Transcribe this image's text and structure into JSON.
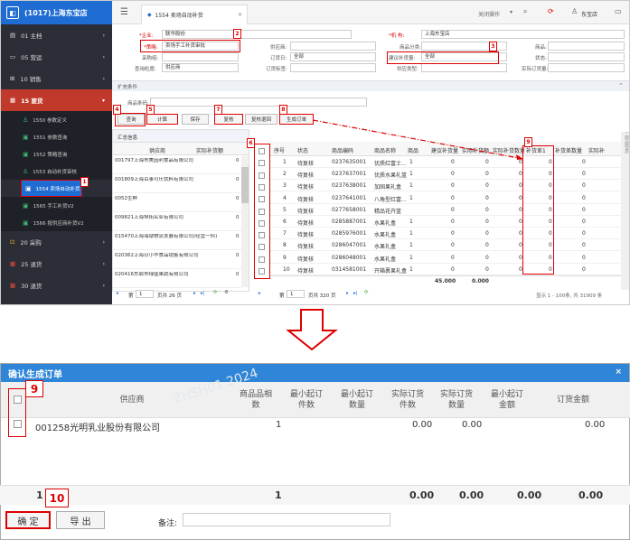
{
  "app": {
    "brand": "(1017)上海东宝店"
  },
  "sidebar": {
    "items": [
      {
        "label": "01 主档"
      },
      {
        "label": "05 营运"
      },
      {
        "label": "10 销售"
      },
      {
        "label": "15 要货"
      }
    ],
    "sub_items": [
      {
        "label": "1550 参数定义"
      },
      {
        "label": "1551 参数查询"
      },
      {
        "label": "1552 策略查询"
      },
      {
        "label": "1553 自动补货审核"
      },
      {
        "label": "1554 卖场自动补货"
      },
      {
        "label": "1565 手工补货V2"
      },
      {
        "label": "1566 按供应商补货V2"
      }
    ],
    "bottom_items": [
      {
        "label": "20 采购"
      },
      {
        "label": "25 退货"
      },
      {
        "label": "30 退货"
      }
    ]
  },
  "header": {
    "tab_label": "1554 卖场自动补货",
    "menu_label": "关闭操作",
    "store_label": "东宝店"
  },
  "form": {
    "enterprise_label": "*企业:",
    "enterprise_value": "联华股份",
    "org_label": "*机 构:",
    "org_value": "上海东宝店",
    "strategy_label": "*策略:",
    "strategy_value": "卖场手工补货审批",
    "supplier_label": "供应商:",
    "category_label": "商品分类:",
    "goods_label": "商品:",
    "purchaser_label": "采购组:",
    "order_day_label": "订货日:",
    "order_day_value": "全部",
    "suggest_label": "建议补货量:",
    "suggest_value": "全部",
    "status_label": "状态:",
    "season_label": "查询粒度:",
    "season_value": "供应商",
    "order_tag_label": "订货标签:",
    "supplier_type_label": "供应类型:",
    "actual_label": "实际订货量:",
    "expand_label": "扩充条件",
    "goods_cond_label": "商品条码:"
  },
  "toolbar": {
    "query": "查询",
    "calc": "计算",
    "save": "保存",
    "review": "复核",
    "review_back": "复核退回",
    "gen_order": "生成订单"
  },
  "left_grid": {
    "title": "汇总信息",
    "headers": [
      "供应商",
      "实际补货额"
    ],
    "rows": [
      {
        "supplier": "001797上海市美因利食品有限公司",
        "value": "0"
      },
      {
        "supplier": "001809上海百事可乐饮料有限公司",
        "value": "0"
      },
      {
        "supplier": "0052生鲜",
        "value": "0"
      },
      {
        "supplier": "009821上海恒拓实业有限公司",
        "value": "0"
      },
      {
        "supplier": "015470上海海墩物流发展有限公司(经营一科)",
        "value": "0"
      },
      {
        "supplier": "020362上海日小华食品销售有限公司",
        "value": "0"
      },
      {
        "supplier": "020416东启市绿盛果蔬有限公司",
        "value": "0"
      }
    ],
    "page": "1",
    "page_total": "页共 26 页",
    "first_label": "第"
  },
  "right_grid": {
    "headers": [
      "序号",
      "状态",
      "商品编码",
      "商品名称",
      "商品",
      "建议补货量",
      "实际补货额",
      "实际补货数量",
      "补货差1",
      "补货差数量",
      "实际补"
    ],
    "rows": [
      {
        "idx": "1",
        "status": "待复核",
        "code": "0237635001",
        "name": "优质红富士...",
        "g": "1",
        "a": "0",
        "b": "0",
        "c": "0",
        "d": "0",
        "e": "0"
      },
      {
        "idx": "2",
        "status": "待复核",
        "code": "0237637001",
        "name": "优质水果礼篮",
        "g": "1",
        "a": "0",
        "b": "0",
        "c": "0",
        "d": "0",
        "e": "0"
      },
      {
        "idx": "3",
        "status": "待复核",
        "code": "0237638001",
        "name": "加固果礼盒",
        "g": "1",
        "a": "0",
        "b": "0",
        "c": "0",
        "d": "0",
        "e": "0"
      },
      {
        "idx": "4",
        "status": "待复核",
        "code": "0237641001",
        "name": "八角型红富...",
        "g": "1",
        "a": "0",
        "b": "0",
        "c": "0",
        "d": "0",
        "e": "0"
      },
      {
        "idx": "5",
        "status": "待复核",
        "code": "0277658001",
        "name": "精品花卉篮",
        "g": "",
        "a": "0",
        "b": "0",
        "c": "0",
        "d": "0",
        "e": "0"
      },
      {
        "idx": "6",
        "status": "待复核",
        "code": "0285887001",
        "name": "水果礼盒",
        "g": "1",
        "a": "0",
        "b": "0",
        "c": "0",
        "d": "0",
        "e": "0"
      },
      {
        "idx": "7",
        "status": "待复核",
        "code": "0285976001",
        "name": "水果礼盒",
        "g": "1",
        "a": "0",
        "b": "0",
        "c": "0",
        "d": "0",
        "e": "0"
      },
      {
        "idx": "8",
        "status": "待复核",
        "code": "0286047001",
        "name": "水果礼盒",
        "g": "1",
        "a": "0",
        "b": "0",
        "c": "0",
        "d": "0",
        "e": "0"
      },
      {
        "idx": "9",
        "status": "待复核",
        "code": "0286048001",
        "name": "水果礼盒",
        "g": "1",
        "a": "0",
        "b": "0",
        "c": "0",
        "d": "0",
        "e": "0"
      },
      {
        "idx": "10",
        "status": "待复核",
        "code": "0314581001",
        "name": "开箱裹果礼盒",
        "g": "1",
        "a": "0",
        "b": "0",
        "c": "0",
        "d": "0",
        "e": "0"
      }
    ],
    "totals": {
      "a": "45.000",
      "b": "0.000"
    },
    "page": "1",
    "page_total": "页共 320 页",
    "first_label": "第",
    "summary": "显示 1 - 100条, 共 31909 条"
  },
  "callouts": [
    "1",
    "2",
    "3",
    "4",
    "5",
    "6",
    "7",
    "8",
    "9",
    "10"
  ],
  "dialog": {
    "title": "确认生成订单",
    "close": "×",
    "headers": {
      "supplier": "供应商",
      "goods_count": "商品品相数",
      "min_pieces": "最小起订件数",
      "min_qty": "最小起订数量",
      "actual_pieces": "实际订货件数",
      "actual_qty": "实际订货数量",
      "min_amount": "最小起订金额",
      "order_amount": "订货金额"
    },
    "row": {
      "supplier": "001258光明乳业股份有限公司",
      "goods_count": "1",
      "actual_pieces": "0.00",
      "actual_qty": "0.00",
      "order_amount": "0.00"
    },
    "footer": {
      "count": "1",
      "goods_count": "1",
      "actual_pieces": "0.00",
      "actual_qty": "0.00",
      "min_amount": "0.00",
      "order_amount": "0.00"
    },
    "confirm_label": "确 定",
    "export_label": "导 出",
    "remark_label": "备注:"
  },
  "colors": {
    "accent": "#1f6dd3",
    "sidebar": "#2b2e36",
    "callout": "#dd0000",
    "dialog_title": "#2f86d8"
  }
}
